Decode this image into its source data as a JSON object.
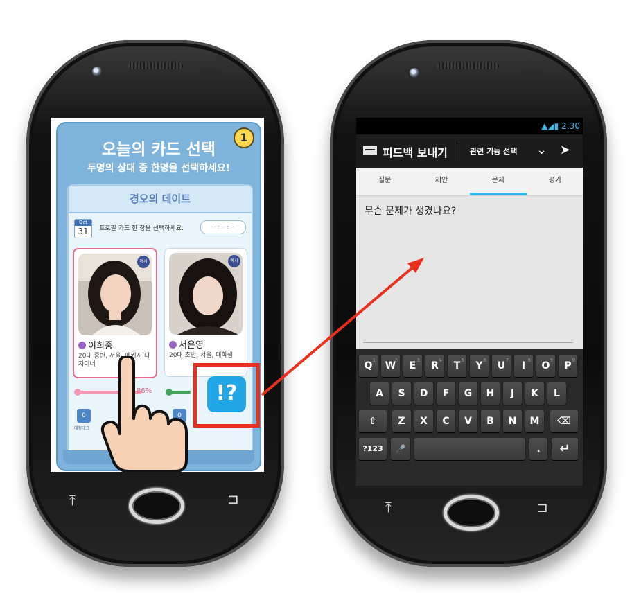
{
  "left_phone": {
    "app": {
      "title": "오늘의 카드 선택",
      "step": "1",
      "subtitle": "두명의 상대 중 한명을 선택하세요!",
      "card_header": "경오의 데이트",
      "calendar_month": "Oct",
      "calendar_day": "31",
      "instruction": "프로필 카드 한 장을 선택하세요.",
      "timer": "-- : -- : --",
      "profiles": [
        {
          "name": "이희중",
          "desc": "20대 중반, 서울, 패키지 디자이너",
          "badge": "예시"
        },
        {
          "name": "서은영",
          "desc": "20대 초반, 서울, 대학생",
          "badge": "예시"
        }
      ],
      "match_percent": "86%",
      "match_count_1": "0",
      "match_count_2": "0",
      "match_tag_label": "매칭태그"
    },
    "feedback_icon": "!?"
  },
  "right_phone": {
    "status_time": "2:30",
    "action_bar": {
      "title": "피드백 보내기",
      "selector": "관련 기능 선택",
      "chevron_icon": "chevron-down-icon",
      "send_icon": "send-icon"
    },
    "tabs": [
      "질문",
      "제안",
      "문제",
      "평가"
    ],
    "active_tab": "문제",
    "question": "무슨 문제가 생겼나요?",
    "keyboard": {
      "row1": [
        "Q",
        "W",
        "E",
        "R",
        "T",
        "Y",
        "U",
        "I",
        "O",
        "P"
      ],
      "row1_hints": [
        "1",
        "2",
        "3",
        "4",
        "5",
        "6",
        "7",
        "8",
        "9",
        "0"
      ],
      "row2": [
        "A",
        "S",
        "D",
        "F",
        "G",
        "H",
        "J",
        "K",
        "L"
      ],
      "row3": [
        "Z",
        "X",
        "C",
        "V",
        "B",
        "N",
        "M"
      ],
      "shift_icon": "⇧",
      "delete_icon": "⌫",
      "symbols": "?123",
      "mic_icon": "🎤",
      "period": ".",
      "enter_icon": "↵"
    }
  },
  "colors": {
    "highlight": "#e8301d",
    "app_blue": "#7eb3dc",
    "holo_blue": "#33b5e5",
    "pink": "#e26a8e"
  }
}
